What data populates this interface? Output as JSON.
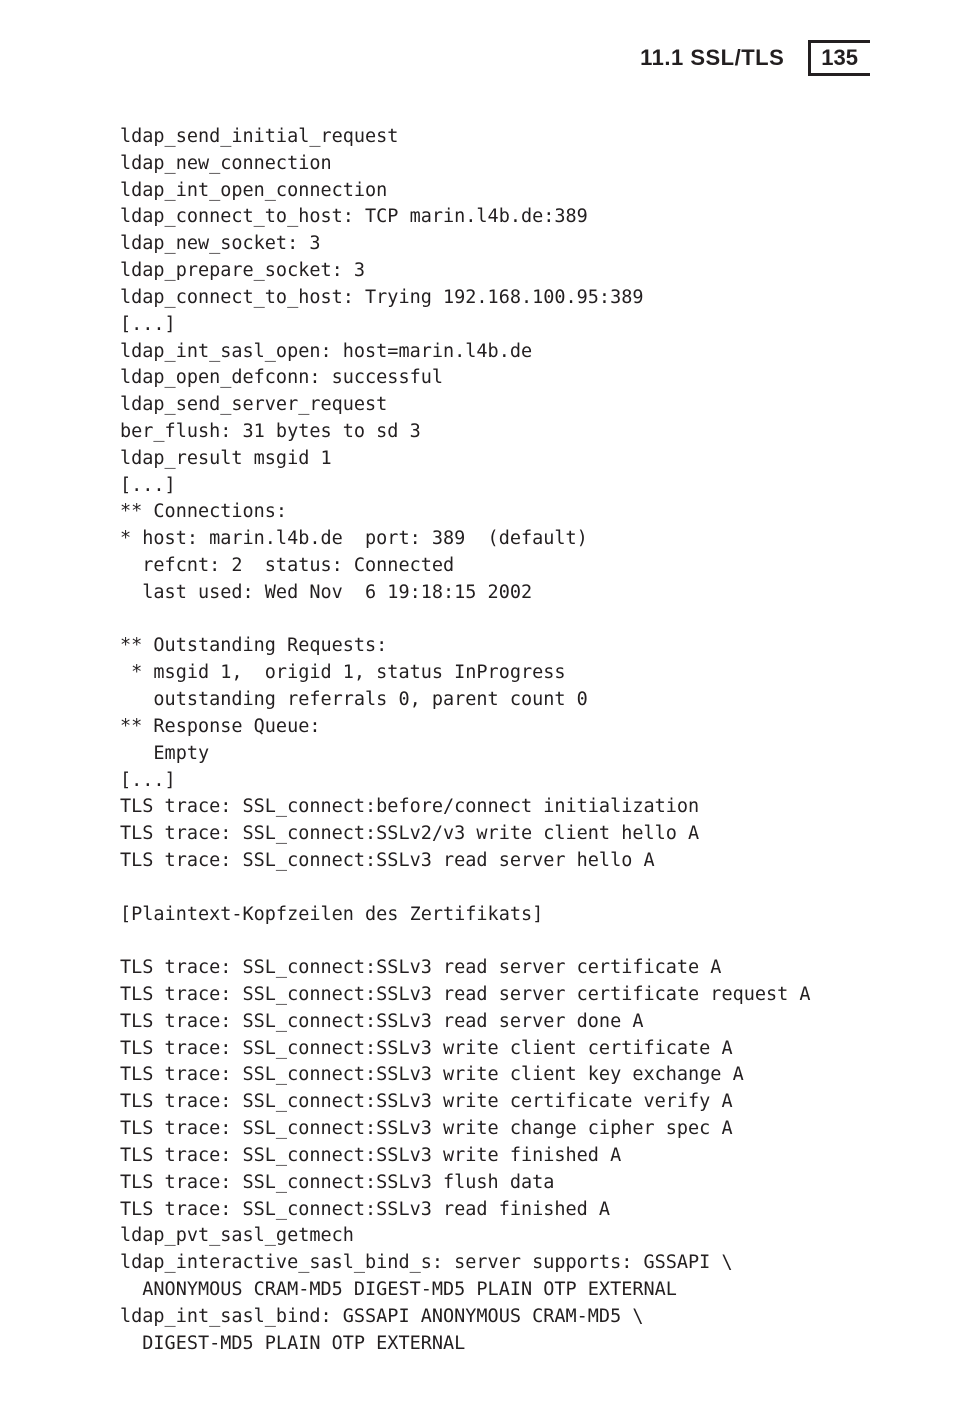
{
  "header": {
    "section_title": "11.1 SSL/TLS",
    "page_number": "135"
  },
  "code_lines": [
    "ldap_send_initial_request",
    "ldap_new_connection",
    "ldap_int_open_connection",
    "ldap_connect_to_host: TCP marin.l4b.de:389",
    "ldap_new_socket: 3",
    "ldap_prepare_socket: 3",
    "ldap_connect_to_host: Trying 192.168.100.95:389",
    "[...]",
    "ldap_int_sasl_open: host=marin.l4b.de",
    "ldap_open_defconn: successful",
    "ldap_send_server_request",
    "ber_flush: 31 bytes to sd 3",
    "ldap_result msgid 1",
    "[...]",
    "** Connections:",
    "* host: marin.l4b.de  port: 389  (default)",
    "  refcnt: 2  status: Connected",
    "  last used: Wed Nov  6 19:18:15 2002",
    "",
    "** Outstanding Requests:",
    " * msgid 1,  origid 1, status InProgress",
    "   outstanding referrals 0, parent count 0",
    "** Response Queue:",
    "   Empty",
    "[...]",
    "TLS trace: SSL_connect:before/connect initialization",
    "TLS trace: SSL_connect:SSLv2/v3 write client hello A",
    "TLS trace: SSL_connect:SSLv3 read server hello A",
    "",
    "[Plaintext-Kopfzeilen des Zertifikats]",
    "",
    "TLS trace: SSL_connect:SSLv3 read server certificate A",
    "TLS trace: SSL_connect:SSLv3 read server certificate request A",
    "TLS trace: SSL_connect:SSLv3 read server done A",
    "TLS trace: SSL_connect:SSLv3 write client certificate A",
    "TLS trace: SSL_connect:SSLv3 write client key exchange A",
    "TLS trace: SSL_connect:SSLv3 write certificate verify A",
    "TLS trace: SSL_connect:SSLv3 write change cipher spec A",
    "TLS trace: SSL_connect:SSLv3 write finished A",
    "TLS trace: SSL_connect:SSLv3 flush data",
    "TLS trace: SSL_connect:SSLv3 read finished A",
    "ldap_pvt_sasl_getmech",
    "ldap_interactive_sasl_bind_s: server supports: GSSAPI \\",
    "  ANONYMOUS CRAM-MD5 DIGEST-MD5 PLAIN OTP EXTERNAL",
    "ldap_int_sasl_bind: GSSAPI ANONYMOUS CRAM-MD5 \\",
    "  DIGEST-MD5 PLAIN OTP EXTERNAL"
  ]
}
